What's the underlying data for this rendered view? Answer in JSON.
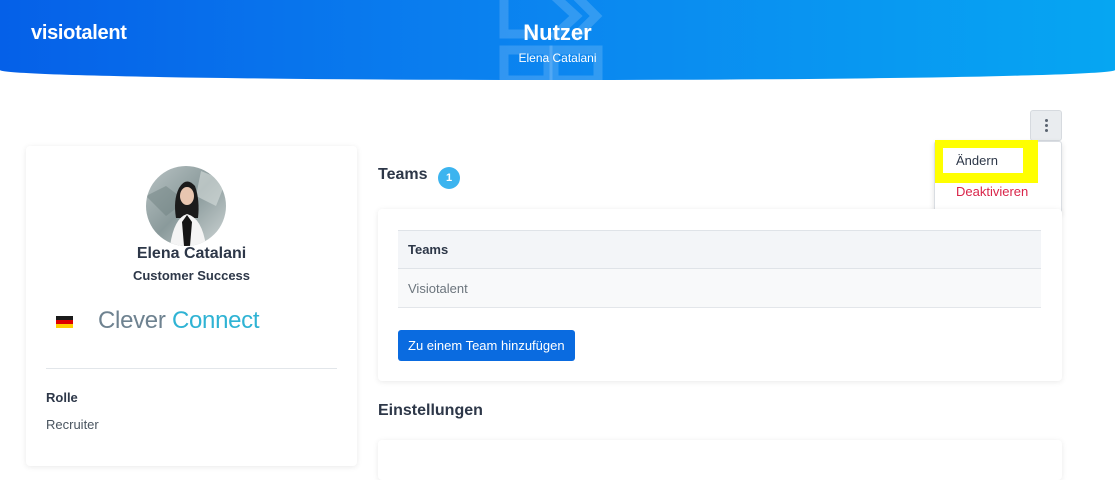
{
  "header": {
    "logo": "visiotalent",
    "title": "Nutzer",
    "subtitle": "Elena Catalani"
  },
  "actions": {
    "menu_icon": "kebab-vertical-icon",
    "edit_label": "Ändern",
    "deactivate_label": "Deaktivieren"
  },
  "profile": {
    "name": "Elena Catalani",
    "position": "Customer Success",
    "country_flag": "germany-flag-icon",
    "company_word1": "Clever",
    "company_word2": "Connect",
    "role_label": "Rolle",
    "role_value": "Recruiter"
  },
  "teams": {
    "heading": "Teams",
    "count": "1",
    "table_header": "Teams",
    "rows": [
      {
        "name": "Visiotalent"
      }
    ],
    "add_button": "Zu einem Team hinzufügen"
  },
  "settings": {
    "heading": "Einstellungen"
  },
  "colors": {
    "header_start": "#0560e8",
    "header_end": "#06a6f2",
    "primary_button": "#0a6be0",
    "badge": "#3cb4ef",
    "danger": "#d9254a",
    "highlight": "#ffff00",
    "brand_gray": "#6e8290",
    "brand_cyan": "#2fb3d4"
  }
}
